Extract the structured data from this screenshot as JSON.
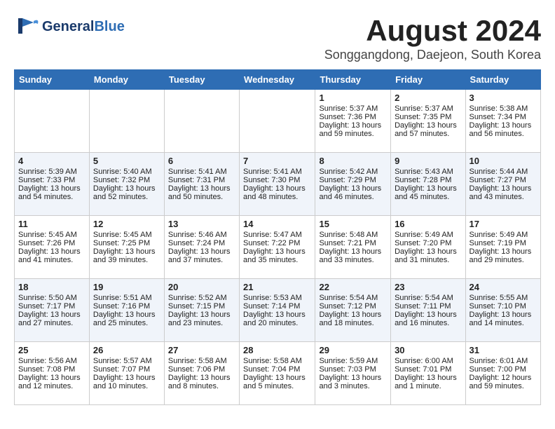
{
  "header": {
    "logo_general": "General",
    "logo_blue": "Blue",
    "month": "August 2024",
    "location": "Songgangdong, Daejeon, South Korea"
  },
  "columns": [
    "Sunday",
    "Monday",
    "Tuesday",
    "Wednesday",
    "Thursday",
    "Friday",
    "Saturday"
  ],
  "weeks": [
    [
      {
        "day": "",
        "data": ""
      },
      {
        "day": "",
        "data": ""
      },
      {
        "day": "",
        "data": ""
      },
      {
        "day": "",
        "data": ""
      },
      {
        "day": "1",
        "data": "Sunrise: 5:37 AM\nSunset: 7:36 PM\nDaylight: 13 hours\nand 59 minutes."
      },
      {
        "day": "2",
        "data": "Sunrise: 5:37 AM\nSunset: 7:35 PM\nDaylight: 13 hours\nand 57 minutes."
      },
      {
        "day": "3",
        "data": "Sunrise: 5:38 AM\nSunset: 7:34 PM\nDaylight: 13 hours\nand 56 minutes."
      }
    ],
    [
      {
        "day": "4",
        "data": "Sunrise: 5:39 AM\nSunset: 7:33 PM\nDaylight: 13 hours\nand 54 minutes."
      },
      {
        "day": "5",
        "data": "Sunrise: 5:40 AM\nSunset: 7:32 PM\nDaylight: 13 hours\nand 52 minutes."
      },
      {
        "day": "6",
        "data": "Sunrise: 5:41 AM\nSunset: 7:31 PM\nDaylight: 13 hours\nand 50 minutes."
      },
      {
        "day": "7",
        "data": "Sunrise: 5:41 AM\nSunset: 7:30 PM\nDaylight: 13 hours\nand 48 minutes."
      },
      {
        "day": "8",
        "data": "Sunrise: 5:42 AM\nSunset: 7:29 PM\nDaylight: 13 hours\nand 46 minutes."
      },
      {
        "day": "9",
        "data": "Sunrise: 5:43 AM\nSunset: 7:28 PM\nDaylight: 13 hours\nand 45 minutes."
      },
      {
        "day": "10",
        "data": "Sunrise: 5:44 AM\nSunset: 7:27 PM\nDaylight: 13 hours\nand 43 minutes."
      }
    ],
    [
      {
        "day": "11",
        "data": "Sunrise: 5:45 AM\nSunset: 7:26 PM\nDaylight: 13 hours\nand 41 minutes."
      },
      {
        "day": "12",
        "data": "Sunrise: 5:45 AM\nSunset: 7:25 PM\nDaylight: 13 hours\nand 39 minutes."
      },
      {
        "day": "13",
        "data": "Sunrise: 5:46 AM\nSunset: 7:24 PM\nDaylight: 13 hours\nand 37 minutes."
      },
      {
        "day": "14",
        "data": "Sunrise: 5:47 AM\nSunset: 7:22 PM\nDaylight: 13 hours\nand 35 minutes."
      },
      {
        "day": "15",
        "data": "Sunrise: 5:48 AM\nSunset: 7:21 PM\nDaylight: 13 hours\nand 33 minutes."
      },
      {
        "day": "16",
        "data": "Sunrise: 5:49 AM\nSunset: 7:20 PM\nDaylight: 13 hours\nand 31 minutes."
      },
      {
        "day": "17",
        "data": "Sunrise: 5:49 AM\nSunset: 7:19 PM\nDaylight: 13 hours\nand 29 minutes."
      }
    ],
    [
      {
        "day": "18",
        "data": "Sunrise: 5:50 AM\nSunset: 7:17 PM\nDaylight: 13 hours\nand 27 minutes."
      },
      {
        "day": "19",
        "data": "Sunrise: 5:51 AM\nSunset: 7:16 PM\nDaylight: 13 hours\nand 25 minutes."
      },
      {
        "day": "20",
        "data": "Sunrise: 5:52 AM\nSunset: 7:15 PM\nDaylight: 13 hours\nand 23 minutes."
      },
      {
        "day": "21",
        "data": "Sunrise: 5:53 AM\nSunset: 7:14 PM\nDaylight: 13 hours\nand 20 minutes."
      },
      {
        "day": "22",
        "data": "Sunrise: 5:54 AM\nSunset: 7:12 PM\nDaylight: 13 hours\nand 18 minutes."
      },
      {
        "day": "23",
        "data": "Sunrise: 5:54 AM\nSunset: 7:11 PM\nDaylight: 13 hours\nand 16 minutes."
      },
      {
        "day": "24",
        "data": "Sunrise: 5:55 AM\nSunset: 7:10 PM\nDaylight: 13 hours\nand 14 minutes."
      }
    ],
    [
      {
        "day": "25",
        "data": "Sunrise: 5:56 AM\nSunset: 7:08 PM\nDaylight: 13 hours\nand 12 minutes."
      },
      {
        "day": "26",
        "data": "Sunrise: 5:57 AM\nSunset: 7:07 PM\nDaylight: 13 hours\nand 10 minutes."
      },
      {
        "day": "27",
        "data": "Sunrise: 5:58 AM\nSunset: 7:06 PM\nDaylight: 13 hours\nand 8 minutes."
      },
      {
        "day": "28",
        "data": "Sunrise: 5:58 AM\nSunset: 7:04 PM\nDaylight: 13 hours\nand 5 minutes."
      },
      {
        "day": "29",
        "data": "Sunrise: 5:59 AM\nSunset: 7:03 PM\nDaylight: 13 hours\nand 3 minutes."
      },
      {
        "day": "30",
        "data": "Sunrise: 6:00 AM\nSunset: 7:01 PM\nDaylight: 13 hours\nand 1 minute."
      },
      {
        "day": "31",
        "data": "Sunrise: 6:01 AM\nSunset: 7:00 PM\nDaylight: 12 hours\nand 59 minutes."
      }
    ]
  ]
}
